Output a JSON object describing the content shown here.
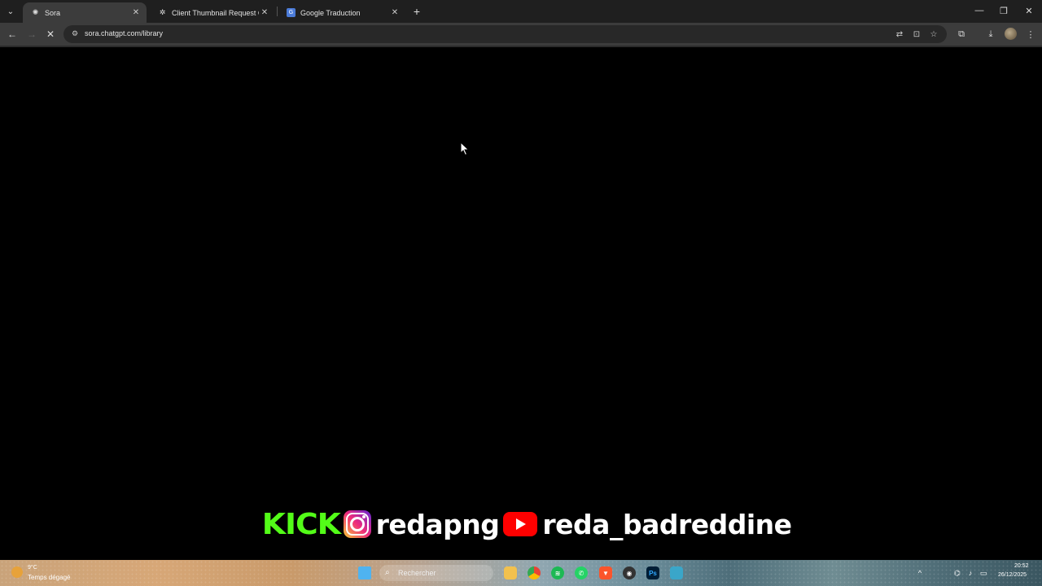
{
  "browser": {
    "tabs": [
      {
        "title": "Sora",
        "active": true
      },
      {
        "title": "Client Thumbnail Request Clari",
        "active": false
      },
      {
        "title": "Google Traduction",
        "active": false
      }
    ],
    "url": "sora.chatgpt.com/library",
    "loading": true
  },
  "overlay": {
    "kick_label": "KICK",
    "instagram_handle": "redapng",
    "youtube_handle": "reda_badreddine"
  },
  "taskbar": {
    "weather_temp": "9°C",
    "weather_desc": "Temps dégagé",
    "search_placeholder": "Rechercher",
    "time": "20:52",
    "date": "26/12/2025"
  },
  "colors": {
    "kick_green": "#53fc18",
    "youtube_red": "#ff0000",
    "tabbar_bg": "#1f1f1f",
    "toolbar_bg": "#3c3c3c"
  }
}
